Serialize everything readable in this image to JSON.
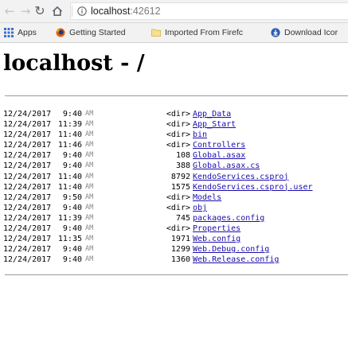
{
  "browser": {
    "url_host": "localhost",
    "url_port": ":42612"
  },
  "bookmarks": [
    {
      "label": "Apps",
      "icon": "apps-grid-icon"
    },
    {
      "label": "Getting Started",
      "icon": "firefox-icon"
    },
    {
      "label": "Imported From Firefc",
      "icon": "folder-icon"
    },
    {
      "label": "Download Icor",
      "icon": "download-icon"
    }
  ],
  "page": {
    "title": "localhost - /"
  },
  "listing": [
    {
      "date": "12/24/2017",
      "time": "9:40",
      "ampm": "AM",
      "size": "<dir>",
      "name": "App_Data"
    },
    {
      "date": "12/24/2017",
      "time": "11:39",
      "ampm": "AM",
      "size": "<dir>",
      "name": "App_Start"
    },
    {
      "date": "12/24/2017",
      "time": "11:40",
      "ampm": "AM",
      "size": "<dir>",
      "name": "bin"
    },
    {
      "date": "12/24/2017",
      "time": "11:46",
      "ampm": "AM",
      "size": "<dir>",
      "name": "Controllers"
    },
    {
      "date": "12/24/2017",
      "time": "9:40",
      "ampm": "AM",
      "size": "108",
      "name": "Global.asax"
    },
    {
      "date": "12/24/2017",
      "time": "9:40",
      "ampm": "AM",
      "size": "388",
      "name": "Global.asax.cs"
    },
    {
      "date": "12/24/2017",
      "time": "11:40",
      "ampm": "AM",
      "size": "8792",
      "name": "KendoServices.csproj"
    },
    {
      "date": "12/24/2017",
      "time": "11:40",
      "ampm": "AM",
      "size": "1575",
      "name": "KendoServices.csproj.user"
    },
    {
      "date": "12/24/2017",
      "time": "9:50",
      "ampm": "AM",
      "size": "<dir>",
      "name": "Models"
    },
    {
      "date": "12/24/2017",
      "time": "9:40",
      "ampm": "AM",
      "size": "<dir>",
      "name": "obj"
    },
    {
      "date": "12/24/2017",
      "time": "11:39",
      "ampm": "AM",
      "size": "745",
      "name": "packages.config"
    },
    {
      "date": "12/24/2017",
      "time": "9:40",
      "ampm": "AM",
      "size": "<dir>",
      "name": "Properties"
    },
    {
      "date": "12/24/2017",
      "time": "11:35",
      "ampm": "AM",
      "size": "1971",
      "name": "Web.config"
    },
    {
      "date": "12/24/2017",
      "time": "9:40",
      "ampm": "AM",
      "size": "1299",
      "name": "Web.Debug.config"
    },
    {
      "date": "12/24/2017",
      "time": "9:40",
      "ampm": "AM",
      "size": "1360",
      "name": "Web.Release.config"
    }
  ]
}
